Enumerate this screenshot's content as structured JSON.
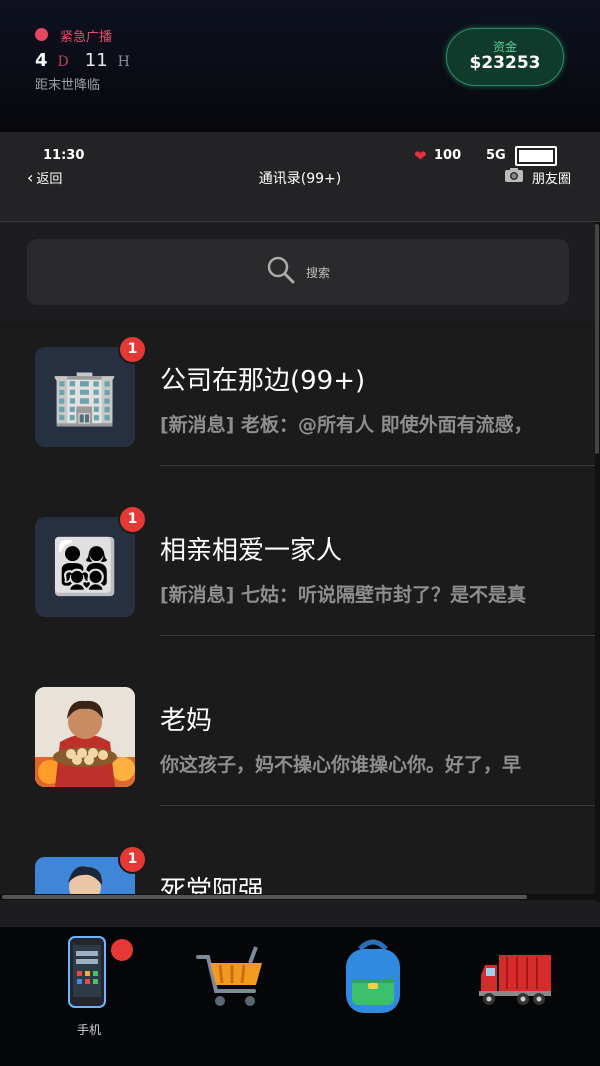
{
  "header": {
    "alert_label": "紧急广播",
    "days_value": "4",
    "days_unit": "D",
    "hours_value": "11",
    "hours_unit": "H",
    "doom_label": "距末世降临",
    "funds_label": "资金",
    "funds_value": "$23253"
  },
  "status_bar": {
    "time": "11:30",
    "health": "100",
    "network": "5G",
    "battery_level": 1.0
  },
  "nav_bar": {
    "back_label": "返回",
    "title": "通讯录(99+)",
    "moments_label": "朋友圈"
  },
  "search": {
    "placeholder": "搜索"
  },
  "chats": [
    {
      "name": "公司在那边(99+)",
      "preview": "[新消息] 老板：@所有人 即使外面有流感，",
      "badge": "1",
      "avatar_icon": "office-building-icon"
    },
    {
      "name": "相亲相爱一家人",
      "preview": "[新消息] 七姑：听说隔壁市封了？是不是真",
      "badge": "1",
      "avatar_icon": "family-icon"
    },
    {
      "name": "老妈",
      "preview": "你这孩子，妈不操心你谁操心你。好了，早",
      "badge": "",
      "avatar_icon": "mom-portrait"
    },
    {
      "name": "死党阿强",
      "preview": "",
      "badge": "1",
      "avatar_icon": "friend-portrait"
    }
  ],
  "bottom_nav": [
    {
      "label": "手机",
      "icon": "phone-icon",
      "active": true,
      "has_badge": true
    },
    {
      "label": "",
      "icon": "shopping-cart-icon",
      "active": false,
      "has_badge": false
    },
    {
      "label": "",
      "icon": "backpack-icon",
      "active": false,
      "has_badge": false
    },
    {
      "label": "",
      "icon": "truck-icon",
      "active": false,
      "has_badge": false
    }
  ],
  "colors": {
    "accent_red": "#e53935",
    "funds_green": "#2c8c66",
    "alert_pink": "#e0506a"
  }
}
